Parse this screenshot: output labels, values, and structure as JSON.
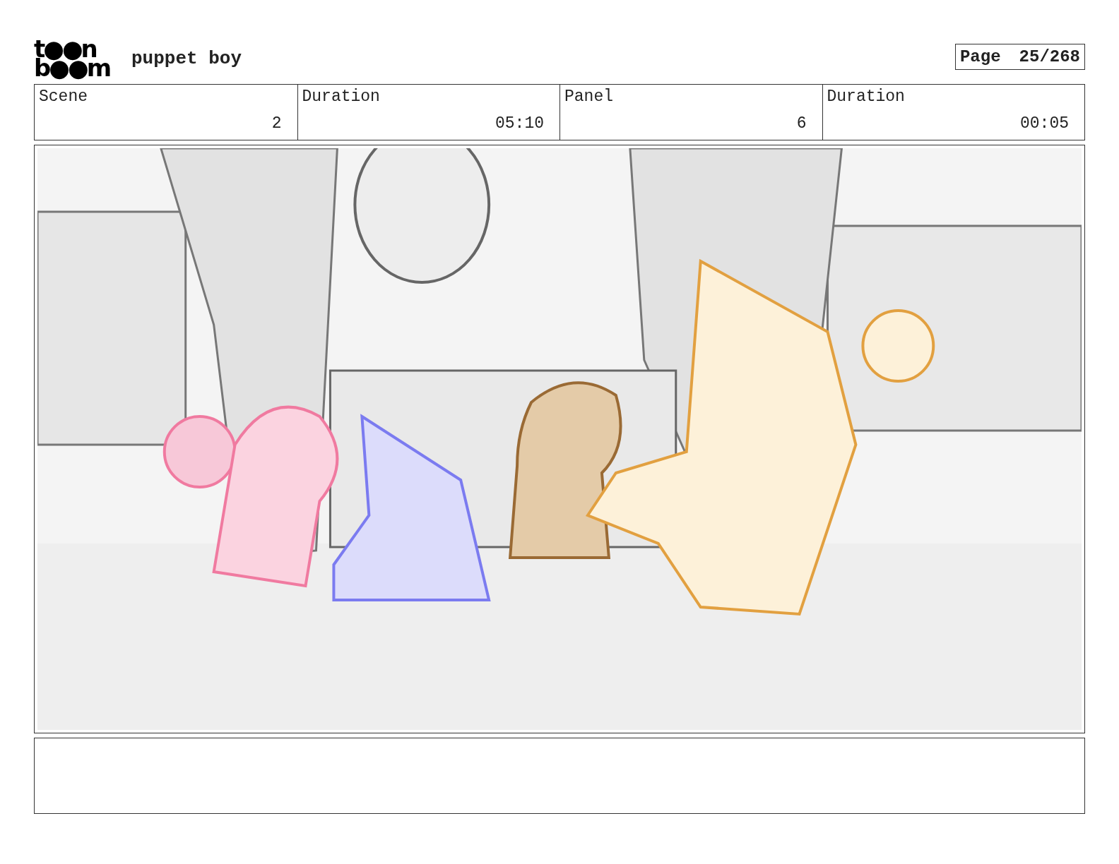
{
  "logo": [
    "t●●n",
    "b●●m"
  ],
  "title": "puppet boy",
  "page": {
    "label": "Page",
    "value": "25/268"
  },
  "info": [
    {
      "label": "Scene",
      "value": "2"
    },
    {
      "label": "Duration",
      "value": "05:10"
    },
    {
      "label": "Panel",
      "value": "6"
    },
    {
      "label": "Duration",
      "value": "00:05"
    }
  ]
}
